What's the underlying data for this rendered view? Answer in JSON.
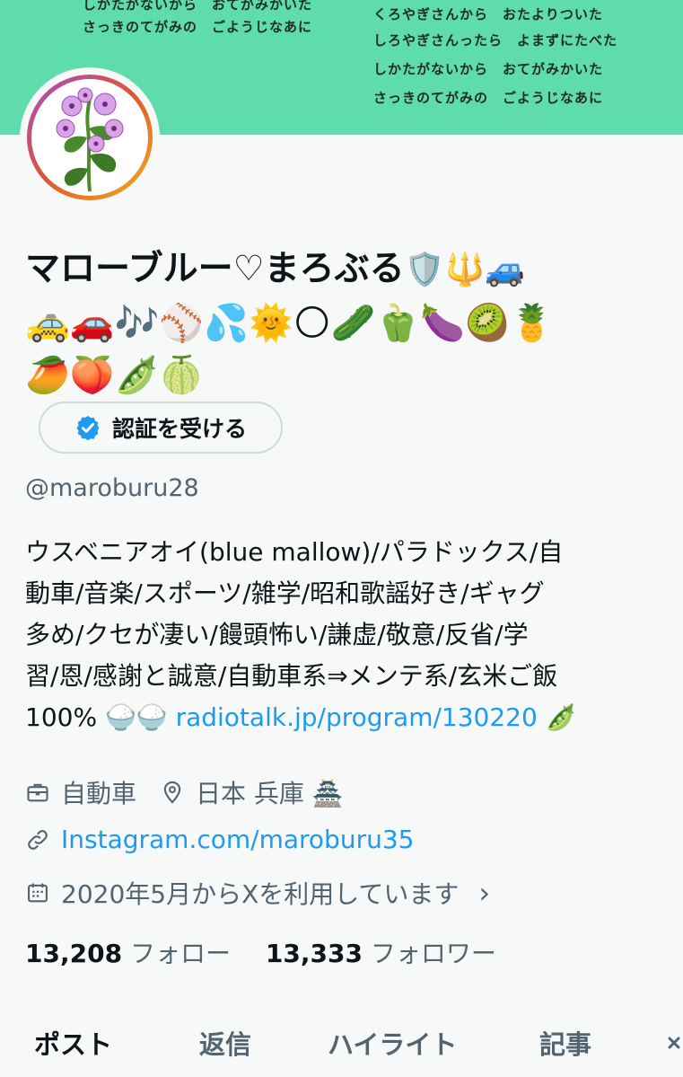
{
  "banner": {
    "left_lines": [
      "しかたがないから　おてがみかいた",
      "さっきのてがみの　ごようじなあに"
    ],
    "right_lines": [
      "くろやぎさんから　おたよりついた",
      "しろやぎさんったら　よまずにたべた",
      "しかたがないから　おてがみかいた",
      "さっきのてがみの　ごようじなあに"
    ]
  },
  "profile": {
    "name": "マローブルー♡まろぶる",
    "name_emoji": "🛡️🔱🚙",
    "emoji_row_1": "🚕🚗🎶⚾💦🌞🌕🥒🫑🍆🥝🍍",
    "emoji_row_2": "🥭🍑🫛🍈",
    "verify_label": "認証を受ける",
    "handle": "@maroburu28"
  },
  "bio": {
    "line1": "ウスベニアオイ(blue mallow)/パラドックス/自",
    "line2": "動車/音楽/スポーツ/雑学/昭和歌謡好き/ギャグ",
    "line3": "多め/クセが凄い/饅頭怖い/謙虚/敬意/反省/学",
    "line4": "習/恩/感謝と誠意/自動車系⇒メンテ系/玄米ご飯",
    "line5_prefix": "100% 🍚🍚 ",
    "line5_link": "radiotalk.jp/program/130220",
    "line5_suffix": " 🫛"
  },
  "meta": {
    "category": "自動車",
    "location": "日本 兵庫 🏯",
    "website": "Instagram.com/maroburu35",
    "joined": "2020年5月からXを利用しています",
    "joined_chevron": "›"
  },
  "stats": {
    "following_count": "13,208",
    "following_label": "フォロー",
    "followers_count": "13,333",
    "followers_label": "フォロワー"
  },
  "tabs": [
    "ポスト",
    "返信",
    "ハイライト",
    "記事"
  ],
  "colors": {
    "banner": "#5fdcab",
    "link": "#1d9bf0",
    "secondary_text": "#536471"
  }
}
